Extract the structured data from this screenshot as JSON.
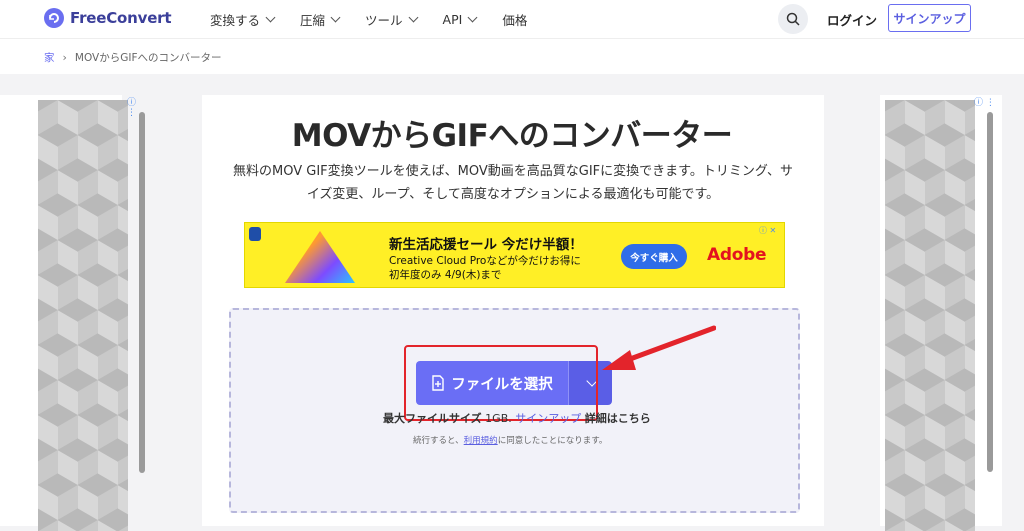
{
  "nav": {
    "brand": "FreeConvert",
    "menu": [
      "変換する",
      "圧縮",
      "ツール",
      "API",
      "価格"
    ],
    "login": "ログイン",
    "signup": "サインアップ"
  },
  "breadcrumb": {
    "home": "家",
    "current": "MOVからGIFへのコンバーター"
  },
  "main": {
    "title": "MOVからGIFへのコンバーター",
    "subtitle": "無料のMOV GIF変換ツールを使えば、MOV動画を高品質なGIFに変換できます。トリミング、サイズ変更、ループ、そして高度なオプションによる最適化も可能です。"
  },
  "banner": {
    "headline": "新生活応援セール 今だけ半額！",
    "line1": "Creative Cloud Proなどが今だけお得に",
    "line2": "初年度のみ 4/9(木)まで",
    "cta": "今すぐ購入",
    "brand": "Adobe"
  },
  "upload": {
    "button": "ファイルを選択",
    "max_label": "最大ファイルサイズ",
    "max_size": "1GB.",
    "signup_link": "サインアップ",
    "detail": "詳細",
    "detail_suffix": "はこちら",
    "terms_prefix": "続行すると、",
    "terms_link": "利用規約",
    "terms_suffix": "に同意したことになります。"
  },
  "colors": {
    "accent": "#6a6ef5",
    "annotation": "#e3242b",
    "banner_bg": "#ffef26",
    "adobe": "#e3131f"
  }
}
